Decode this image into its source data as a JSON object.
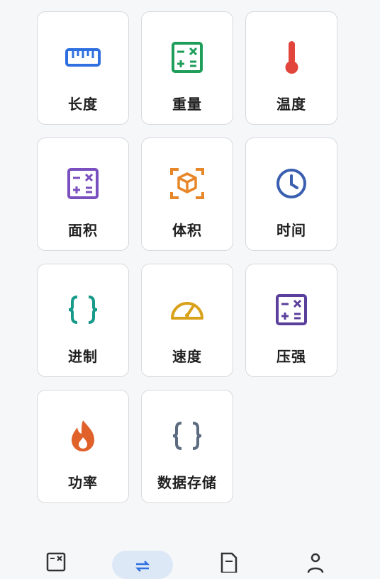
{
  "grid": {
    "items": [
      {
        "label": "长度",
        "icon": "ruler-icon",
        "color": "#2f6fe0"
      },
      {
        "label": "重量",
        "icon": "calculator-icon",
        "color": "#1e9e5a"
      },
      {
        "label": "温度",
        "icon": "thermometer-icon",
        "color": "#e2453c"
      },
      {
        "label": "面积",
        "icon": "calculator-icon",
        "color": "#7a4fbf"
      },
      {
        "label": "体积",
        "icon": "cube-scan-icon",
        "color": "#e8862a"
      },
      {
        "label": "时间",
        "icon": "clock-icon",
        "color": "#3a5fb0"
      },
      {
        "label": "进制",
        "icon": "braces-icon",
        "color": "#179a8a"
      },
      {
        "label": "速度",
        "icon": "speedometer-icon",
        "color": "#d9a21b"
      },
      {
        "label": "压强",
        "icon": "calculator-icon",
        "color": "#5b3f9c"
      },
      {
        "label": "功率",
        "icon": "fire-icon",
        "color": "#e0612a"
      },
      {
        "label": "数据存储",
        "icon": "braces-icon",
        "color": "#5c6b80"
      }
    ]
  },
  "bottom_nav": {
    "items": [
      {
        "icon": "calculator-tab-icon"
      },
      {
        "icon": "convert-tab-icon",
        "active": true,
        "accent": "#2f6fe0"
      },
      {
        "icon": "document-tab-icon"
      },
      {
        "icon": "profile-tab-icon"
      }
    ]
  }
}
